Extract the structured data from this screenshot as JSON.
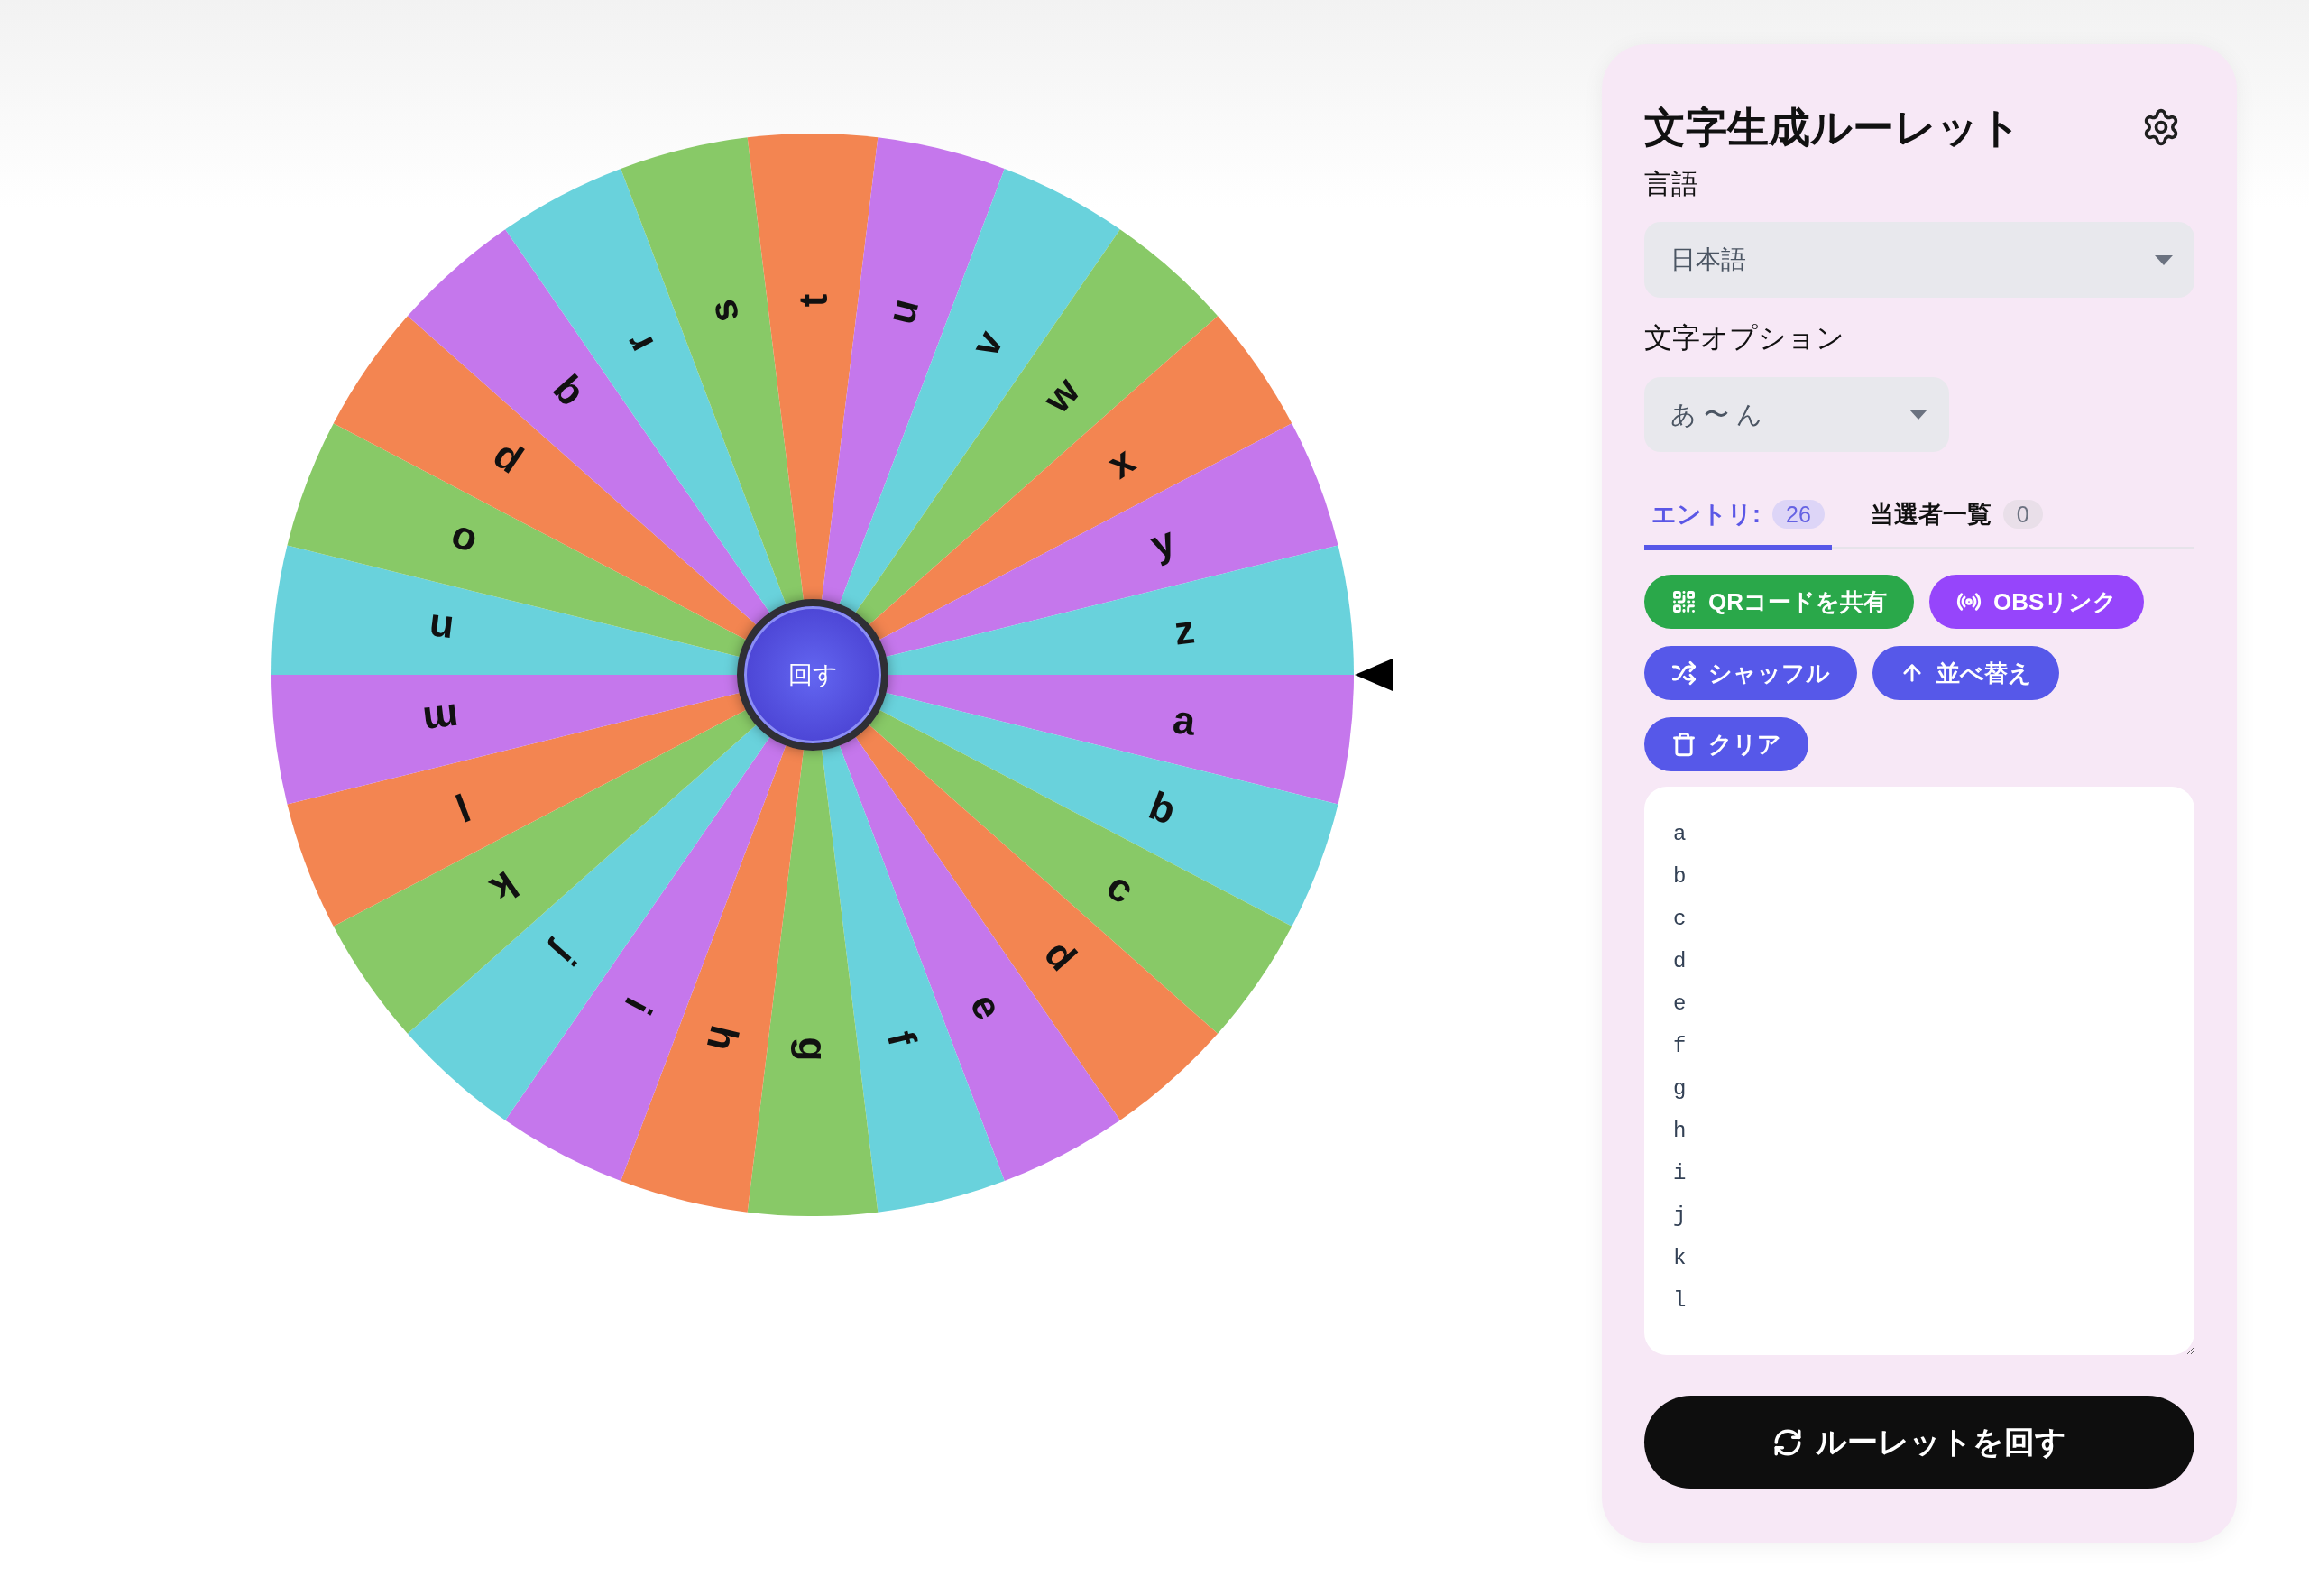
{
  "wheel": {
    "segments": [
      {
        "label": "a",
        "color": "#c577ec"
      },
      {
        "label": "b",
        "color": "#69d2dc"
      },
      {
        "label": "c",
        "color": "#88c967"
      },
      {
        "label": "d",
        "color": "#f38551"
      },
      {
        "label": "e",
        "color": "#c577ec"
      },
      {
        "label": "f",
        "color": "#69d2dc"
      },
      {
        "label": "g",
        "color": "#88c967"
      },
      {
        "label": "h",
        "color": "#f38551"
      },
      {
        "label": "i",
        "color": "#c577ec"
      },
      {
        "label": "j",
        "color": "#69d2dc"
      },
      {
        "label": "k",
        "color": "#88c967"
      },
      {
        "label": "l",
        "color": "#f38551"
      },
      {
        "label": "m",
        "color": "#c577ec"
      },
      {
        "label": "n",
        "color": "#69d2dc"
      },
      {
        "label": "o",
        "color": "#88c967"
      },
      {
        "label": "p",
        "color": "#f38551"
      },
      {
        "label": "q",
        "color": "#c577ec"
      },
      {
        "label": "r",
        "color": "#69d2dc"
      },
      {
        "label": "s",
        "color": "#88c967"
      },
      {
        "label": "t",
        "color": "#f38551"
      },
      {
        "label": "u",
        "color": "#c577ec"
      },
      {
        "label": "v",
        "color": "#69d2dc"
      },
      {
        "label": "w",
        "color": "#88c967"
      },
      {
        "label": "x",
        "color": "#f38551"
      },
      {
        "label": "y",
        "color": "#c577ec"
      },
      {
        "label": "z",
        "color": "#69d2dc"
      }
    ],
    "hub_label": "回す"
  },
  "panel": {
    "title": "文字生成ルーレット",
    "language": {
      "label": "言語",
      "value": "日本語"
    },
    "character_option": {
      "label": "文字オプション",
      "value": "あ 〜 ん"
    },
    "tabs": [
      {
        "label": "エントリ:",
        "count": "26",
        "selected": true
      },
      {
        "label": "当選者一覧",
        "count": "0",
        "selected": false
      }
    ],
    "actions": [
      {
        "label": "QRコードを共有",
        "kind": "share",
        "color": "#2aa84a"
      },
      {
        "label": "OBSリンク",
        "kind": "obs",
        "color": "#9645fb"
      },
      {
        "label": "シャッフル",
        "kind": "shuffle",
        "color": "#5658e9"
      },
      {
        "label": "並べ替え",
        "kind": "sort",
        "color": "#5658e9"
      },
      {
        "label": "クリア",
        "kind": "clear",
        "color": "#5658e9"
      }
    ],
    "entries": [
      "a",
      "b",
      "c",
      "d",
      "e",
      "f",
      "g",
      "h",
      "i",
      "j",
      "k",
      "l"
    ],
    "spin_button": "ルーレットを回す"
  }
}
